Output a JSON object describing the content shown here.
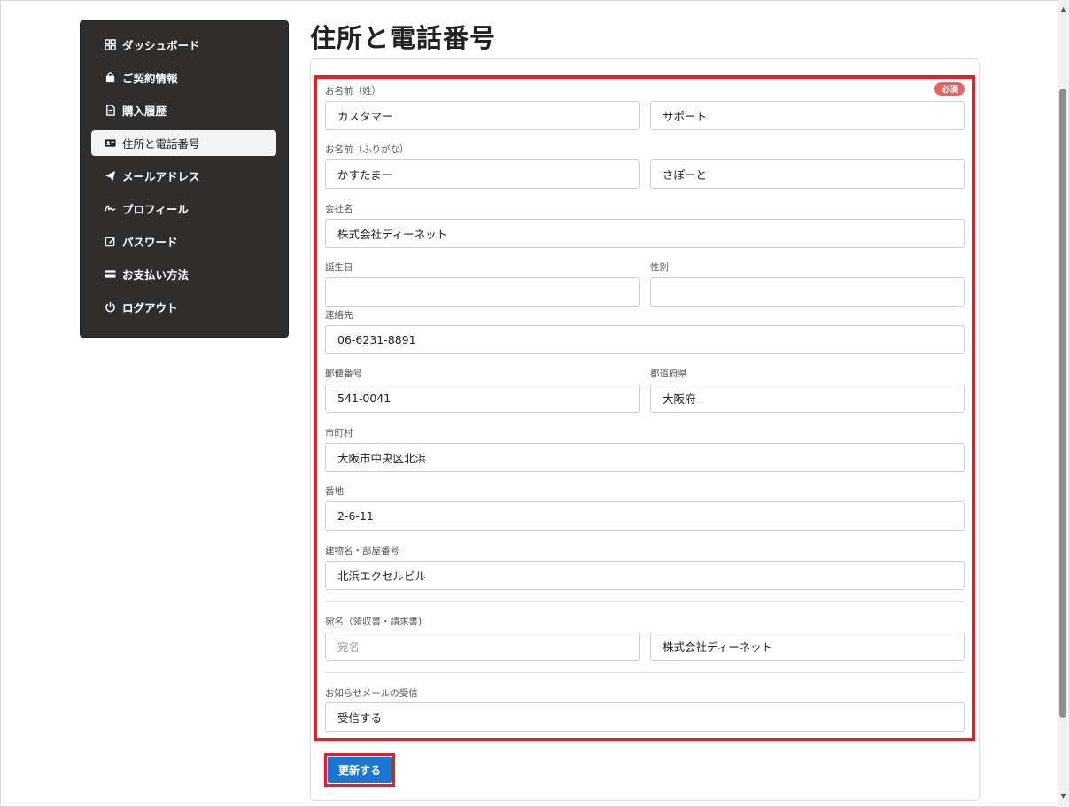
{
  "sidebar": {
    "items": [
      {
        "label": "ダッシュボード",
        "icon": "dashboard-icon"
      },
      {
        "label": "ご契約情報",
        "icon": "bag-icon"
      },
      {
        "label": "購入履歴",
        "icon": "document-icon"
      },
      {
        "label": "住所と電話番号",
        "icon": "id-card-icon",
        "active": true
      },
      {
        "label": "メールアドレス",
        "icon": "paper-plane-icon"
      },
      {
        "label": "プロフィール",
        "icon": "signature-icon"
      },
      {
        "label": "パスワード",
        "icon": "edit-icon"
      },
      {
        "label": "お支払い方法",
        "icon": "credit-card-icon"
      },
      {
        "label": "ログアウト",
        "icon": "power-icon"
      }
    ]
  },
  "page_title": "住所と電話番号",
  "form": {
    "required_badge": "必須",
    "name_label": "お名前（姓）",
    "last_name": "カスタマー",
    "first_name": "サポート",
    "kana_label": "お名前（ふりがな）",
    "last_name_kana": "かすたまー",
    "first_name_kana": "さぽーと",
    "company_label": "会社名",
    "company": "株式会社ディーネット",
    "birthday_label": "誕生日",
    "birthday": "",
    "gender_label": "性別",
    "gender": "",
    "phone_label": "連絡先",
    "phone": "06-6231-8891",
    "zip_label": "郵便番号",
    "zip": "541-0041",
    "prefecture_label": "都道府県",
    "prefecture": "大阪府",
    "city_label": "市町村",
    "city": "大阪市中央区北浜",
    "address_label": "番地",
    "address": "2-6-11",
    "building_label": "建物名・部屋番号",
    "building": "北浜エクセルビル",
    "addressee_label": "宛名（領収書・請求書)",
    "addressee_placeholder": "宛名",
    "addressee_company": "株式会社ディーネット",
    "newsletter_label": "お知らせメールの受信",
    "newsletter": "受信する",
    "submit_label": "更新する"
  },
  "colors": {
    "sidebar_bg": "#302e2c",
    "highlight": "#e0202c",
    "button": "#1a76d2",
    "badge": "#e46464"
  }
}
